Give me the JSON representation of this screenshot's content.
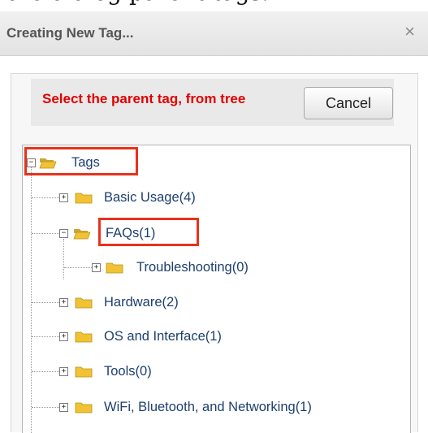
{
  "top_fragment": "the dialog parent tags.",
  "dialog": {
    "title": "Creating New Tag...",
    "close_glyph": "×"
  },
  "prompt": {
    "message": "Select the parent tag, from tree",
    "cancel_label": "Cancel"
  },
  "tree": {
    "root": {
      "label": "Tags",
      "expander": "−",
      "expanded": true
    },
    "items": [
      {
        "label": "Basic Usage(4)",
        "expander": "+",
        "expanded": false
      },
      {
        "label": "FAQs(1)",
        "expander": "−",
        "expanded": true
      },
      {
        "label": "Troubleshooting(0)",
        "expander": "+",
        "expanded": false
      },
      {
        "label": "Hardware(2)",
        "expander": "+",
        "expanded": false
      },
      {
        "label": "OS and Interface(1)",
        "expander": "+",
        "expanded": false
      },
      {
        "label": "Tools(0)",
        "expander": "+",
        "expanded": false
      },
      {
        "label": "WiFi, Bluetooth, and Networking(1)",
        "expander": "+",
        "expanded": false
      }
    ]
  },
  "colors": {
    "prompt_text": "#e00000",
    "highlight_box": "#e8321c",
    "tree_label": "#1d3f6e",
    "folder_fill": "#f1c232"
  },
  "icons": [
    "close-icon",
    "folder-open-icon",
    "folder-closed-icon",
    "expand-icon",
    "collapse-icon"
  ]
}
